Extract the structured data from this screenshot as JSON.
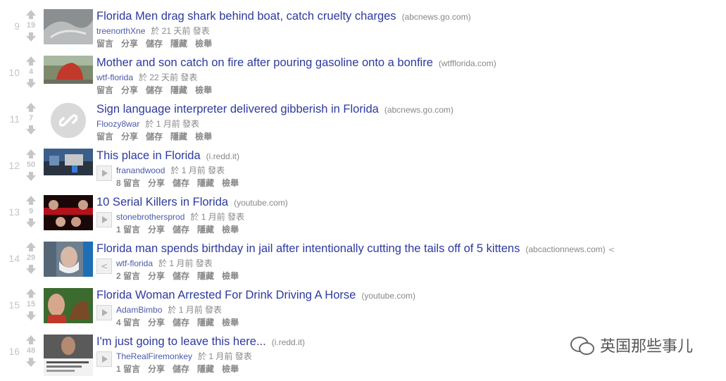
{
  "labels": {
    "comment": "留言",
    "share": "分享",
    "save": "儲存",
    "hide": "隱藏",
    "report": "檢舉"
  },
  "posts": [
    {
      "rank": "9",
      "score": "19",
      "title": "Florida Men drag shark behind boat, catch cruelty charges",
      "domain": "(abcnews.go.com)",
      "author": "treenorthXne",
      "time": "於 21 天前 發表",
      "comments": "留言"
    },
    {
      "rank": "10",
      "score": "4",
      "title": "Mother and son catch on fire after pouring gasoline onto a bonfire",
      "domain": "(wtfflorida.com)",
      "author": "wtf-florida",
      "time": "於 22 天前 發表",
      "comments": "留言"
    },
    {
      "rank": "11",
      "score": "7",
      "title": "Sign language interpreter delivered gibberish in Florida",
      "domain": "(abcnews.go.com)",
      "author": "Floozy8war",
      "time": "於 1 月前 發表",
      "comments": "留言"
    },
    {
      "rank": "12",
      "score": "50",
      "title": "This place in Florida",
      "domain": "(i.redd.it)",
      "author": "franandwood",
      "time": "於 1 月前 發表",
      "comments": "8 留言"
    },
    {
      "rank": "13",
      "score": "9",
      "title": "10 Serial Killers in Florida",
      "domain": "(youtube.com)",
      "author": "stonebrothersprod",
      "time": "於 1 月前 發表",
      "comments": "1 留言"
    },
    {
      "rank": "14",
      "score": "29",
      "title": "Florida man spends birthday in jail after intentionally cutting the tails off of 5 kittens",
      "domain": "(abcactionnews.com)",
      "author": "wtf-florida",
      "time": "於 1 月前 發表",
      "comments": "2 留言"
    },
    {
      "rank": "15",
      "score": "15",
      "title": "Florida Woman Arrested For Drink Driving A Horse",
      "domain": "(youtube.com)",
      "author": "AdamBimbo",
      "time": "於 1 月前 發表",
      "comments": "4 留言"
    },
    {
      "rank": "16",
      "score": "48",
      "title": "I'm just going to leave this here...",
      "domain": "(i.redd.it)",
      "author": "TheRealFiremonkey",
      "time": "於 1 月前 發表",
      "comments": "1 留言"
    }
  ],
  "watermark": "英国那些事儿"
}
